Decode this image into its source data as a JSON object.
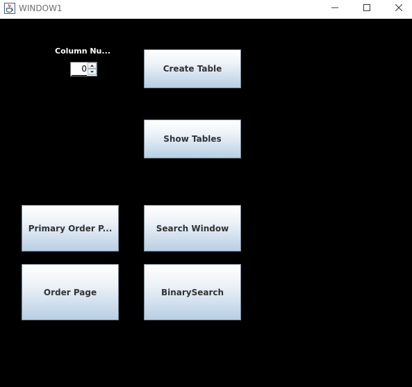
{
  "window": {
    "title": "WINDOW1",
    "app_icon": "java-cup-icon"
  },
  "controls": {
    "minimize_icon": "minimize-icon",
    "maximize_icon": "maximize-icon",
    "close_icon": "close-icon"
  },
  "form": {
    "column_label": "Column Nu...",
    "column_value": "0"
  },
  "buttons": {
    "create_table": "Create Table",
    "show_tables": "Show Tables",
    "primary_order": "Primary Order P...",
    "search_window": "Search Window",
    "order_page": "Order Page",
    "binary_search": "BinarySearch"
  },
  "colors": {
    "background": "#000000",
    "button_text": "#333333"
  }
}
